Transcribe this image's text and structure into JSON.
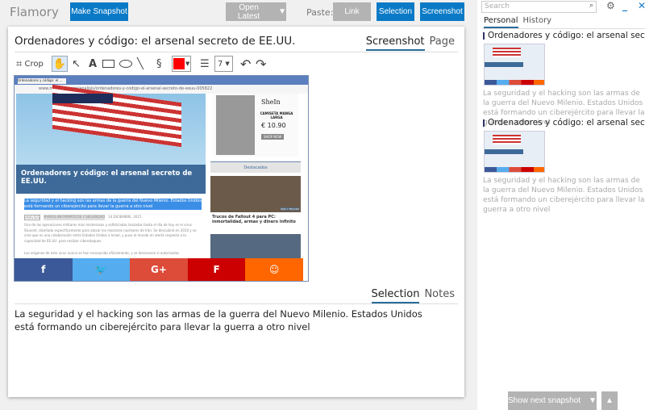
{
  "app": {
    "name": "Flamory",
    "make_snapshot": "Make Snapshot",
    "open_latest": "Open Latest",
    "paste_label": "Paste:",
    "paste_link": "Link",
    "paste_selection": "Selection",
    "paste_screenshot": "Screenshot"
  },
  "doc": {
    "title": "Ordenadores y código: el arsenal secreto de EE.UU.",
    "tabs": [
      "Screenshot",
      "Page"
    ],
    "active_tab": "Screenshot",
    "toolbar": {
      "crop": "Crop",
      "color": "#ff0000",
      "line_width": "7"
    },
    "bottom_tabs": [
      "Selection",
      "Notes"
    ],
    "active_bottom_tab": "Selection",
    "selection_text": "La seguridad y el hacking son las armas de la guerra del Nuevo Milenio. Estados Unidos está formando un ciberejército para llevar la guerra a otro nivel"
  },
  "snapshot": {
    "tab_title": "Ordenadores y código: el ...",
    "url": "www.malavida.com/analisis/ordenadores-y-codigo-el-arsenal-secreto-de-eeuu-005822",
    "headline": "Ordenadores y código: el arsenal secreto de EE.UU.",
    "highlight": "La seguridad y el hacking son las armas de la guerra del Nuevo Milenio. Estados Unidos está formando un ciberejército para llevar la guerra a otro nivel",
    "tag1": "ANÁLISIS",
    "tag2": "#VIRUS INFORMÁTICOS Y SEGURIDAD",
    "date": "14 DICIEMBRE, 2015",
    "body": "Una de las operaciones militares más misteriosas y sofisticadas lanzadas hasta el día de hoy es el virus Stuxnet, diseñado específicamente para atacar los reactores nucleares de Irán. Se descubrió en 2010 y se cree que es una colaboración entre Estados Unidos e Israel, y puso al mundo en alerta respecto a la capacidad de EE.UU. para realizar ciberataques.",
    "body2": "Los orígenes de este virus nunca se han reconocido oficialmente, y se desconoce si autorizados",
    "ad_brand": "SheIn",
    "ad_text": "CAMISETA MANGA LARGA",
    "ad_price": "€ 10.90",
    "ad_button": "SHOP NOW",
    "featured": "Destacados",
    "article2": "Trucos de Fallout 4 para PC: inmortalidad, armas y dinero infinito",
    "badge": "MÁS Y TRUCOS",
    "share": [
      {
        "icon": "facebook-icon",
        "glyph": "f",
        "color": "#3b5998"
      },
      {
        "icon": "twitter-icon",
        "glyph": "🐦",
        "color": "#55acee"
      },
      {
        "icon": "google-plus-icon",
        "glyph": "G+",
        "color": "#dd4b39"
      },
      {
        "icon": "flipboard-icon",
        "glyph": "F",
        "color": "#c00"
      },
      {
        "icon": "meneame-icon",
        "glyph": "☺",
        "color": "#f60"
      }
    ]
  },
  "sidebar": {
    "search_placeholder": "Search",
    "tabs": [
      "Personal",
      "History"
    ],
    "active_tab": "Personal",
    "items": [
      {
        "title": "Ordenadores y código: el arsenal secreto de EE.UU.",
        "desc": "La seguridad y el hacking son las armas de la guerra del Nuevo Milenio. Estados Unidos está formando un ciberejército para llevar la guerra a otro nivel"
      },
      {
        "title": "Ordenadores y código: el arsenal secreto de EE.UU.",
        "desc": "La seguridad y el hacking son las armas de la guerra del Nuevo Milenio. Estados Unidos está formando un ciberejército para llevar la guerra a otro nivel"
      }
    ],
    "show_next": "Show next snapshot"
  }
}
